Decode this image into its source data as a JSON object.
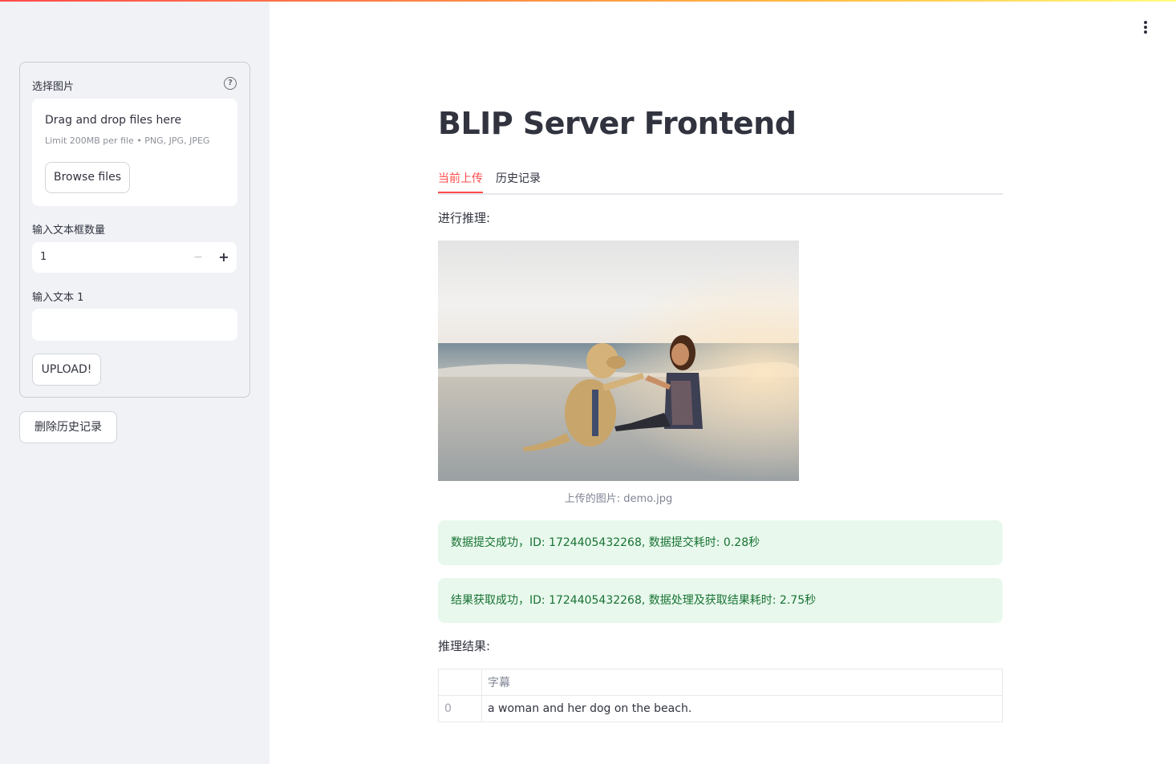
{
  "sidebar": {
    "upload_label": "选择图片",
    "dropzone_title": "Drag and drop files here",
    "dropzone_limit": "Limit 200MB per file • PNG, JPG, JPEG",
    "browse_label": "Browse files",
    "count_label": "输入文本框数量",
    "count_value": "1",
    "text_label": "输入文本 1",
    "text_value": "",
    "upload_button": "UPLOAD!",
    "delete_button": "删除历史记录"
  },
  "main": {
    "title": "BLIP Server Frontend",
    "tabs": [
      {
        "label": "当前上传",
        "active": true
      },
      {
        "label": "历史记录",
        "active": false
      }
    ],
    "inference_label": "进行推理:",
    "image_caption": "上传的图片: demo.jpg",
    "alerts": [
      "数据提交成功，ID: 1724405432268, 数据提交耗时: 0.28秒",
      "结果获取成功，ID: 1724405432268, 数据处理及获取结果耗时: 2.75秒"
    ],
    "result_label": "推理结果:",
    "table": {
      "column": "字幕",
      "rows": [
        {
          "index": "0",
          "caption": "a woman and her dog on the beach."
        }
      ]
    }
  },
  "colors": {
    "accent": "#ff4b4b",
    "success_bg": "#e8f8ec",
    "success_text": "#177233",
    "sidebar_bg": "#f0f2f6"
  }
}
